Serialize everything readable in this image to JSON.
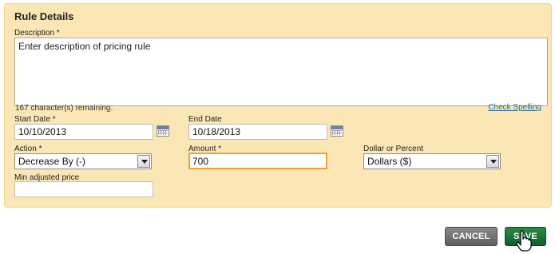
{
  "panel": {
    "title": "Rule Details",
    "description": {
      "label": "Description *",
      "value": "Enter description of pricing rule",
      "remaining": "167 character(s) remaining.",
      "spell_link": "Check Spelling"
    },
    "start_date": {
      "label": "Start Date *",
      "value": "10/10/2013"
    },
    "end_date": {
      "label": "End Date",
      "value": "10/18/2013"
    },
    "action": {
      "label": "Action *",
      "selected": "Decrease By (-)"
    },
    "amount": {
      "label": "Amount *",
      "value": "700"
    },
    "dollar_percent": {
      "label": "Dollar or Percent",
      "selected": "Dollars ($)"
    },
    "min_price": {
      "label": "Min adjusted price",
      "value": ""
    }
  },
  "buttons": {
    "cancel": "CANCEL",
    "save": "SAVE"
  },
  "colors": {
    "panel_bg": "#fbe7b5",
    "save_green": "#1a6f33",
    "focus_orange": "#f0a035",
    "link": "#2a6f97"
  }
}
